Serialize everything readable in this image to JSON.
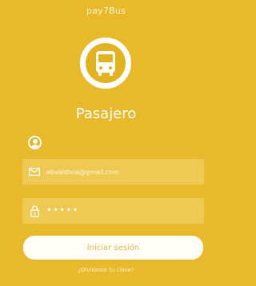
{
  "app": {
    "title": "pay7Bus"
  },
  "header": {
    "role_title": "Pasajero"
  },
  "form": {
    "email_value": "ebvaldivia@gmail.com",
    "password_value": "•••••",
    "login_button": "Iniciar sesión",
    "forgot_link": "¿Olvidaste tu clave?"
  },
  "colors": {
    "background": "#e8b92a",
    "field_bg": "#eec954",
    "button_bg": "#fffdf6",
    "button_text": "#e0b74a"
  },
  "icons": [
    "bus-icon",
    "user-avatar-icon",
    "envelope-icon",
    "lock-icon"
  ]
}
